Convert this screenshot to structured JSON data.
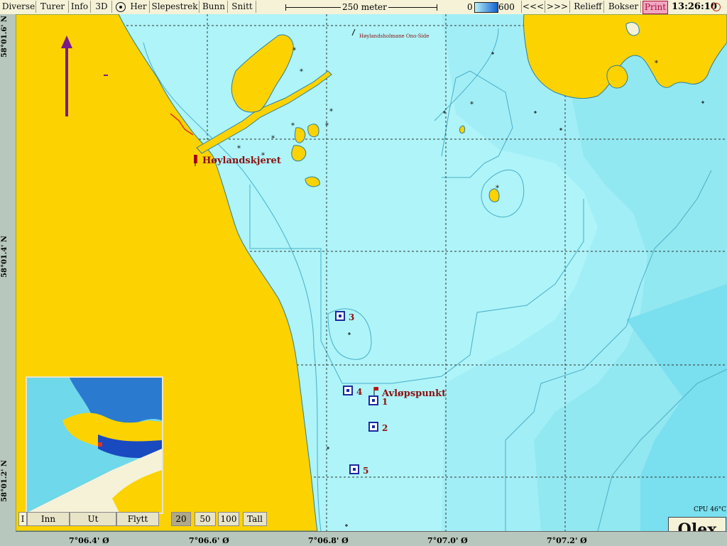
{
  "toolbar": {
    "buttons": [
      "Diverse",
      "Turer",
      "Info",
      "3D",
      "Her",
      "Slepestrek",
      "Bunn",
      "Snitt"
    ],
    "scale_label": "250 meter",
    "depth_min": "0",
    "depth_max": "600",
    "prev": "<<<",
    "next": ">>>",
    "relief": "Relieff",
    "boxes": "Bokser",
    "print": "Print",
    "clock": "13:26:10"
  },
  "axes": {
    "lat": [
      "58°01.6' N",
      "58°01.4' N",
      "58°01.2' N"
    ],
    "lon": [
      "7°06.4' Ø",
      "7°06.6' Ø",
      "7°06.8' Ø",
      "7°07.0' Ø",
      "7°07.2' Ø"
    ]
  },
  "map": {
    "colors": {
      "land": "#fcd200",
      "shallow": "#aef4f8",
      "mid": "#92e8f0",
      "deep": "#72dcec",
      "coast": "#2a7fa0",
      "marker": "#1a2aa0",
      "label": "#8a1010"
    },
    "places": {
      "hoylandskjeret": "Høylandskjeret",
      "hoylandsholmane": "Høylandsholmane Ono-Side",
      "avlopspunkt": "Avløpspunkt"
    },
    "markers": [
      "1",
      "2",
      "3",
      "4",
      "5"
    ]
  },
  "minimap": {
    "controls": {
      "inn": "Inn",
      "ut": "Ut",
      "flytt": "Flytt"
    },
    "scales": [
      "20",
      "50",
      "100"
    ],
    "selected_scale": "20",
    "tall": "Tall",
    "left_label": "I"
  },
  "status": {
    "cpu": "CPU 46°C"
  },
  "logo": "Olex"
}
